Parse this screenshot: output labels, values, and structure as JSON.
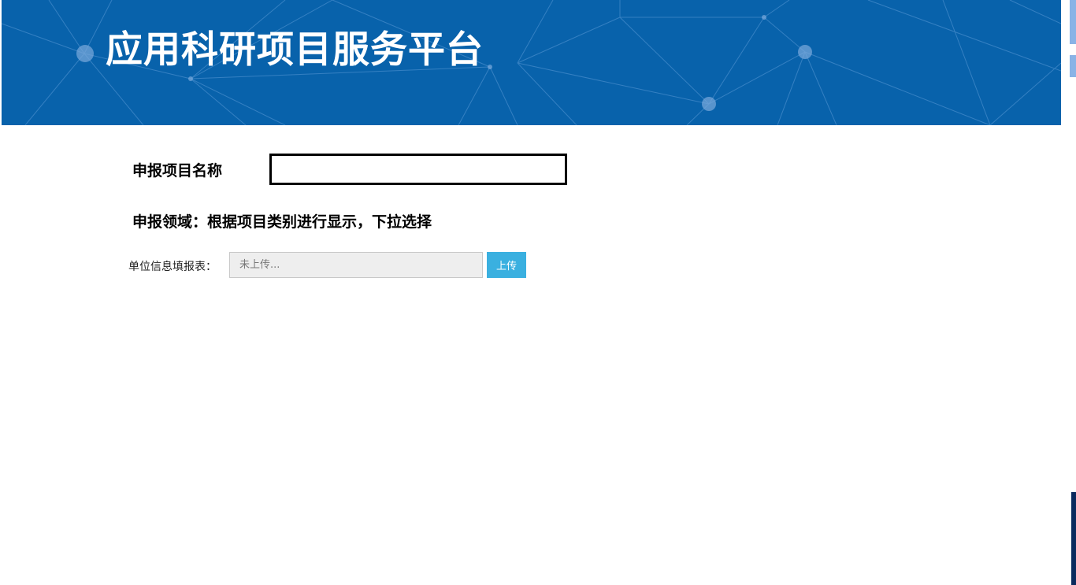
{
  "header": {
    "title": "应用科研项目服务平台",
    "background_color": "#0862ab"
  },
  "form": {
    "project_name": {
      "label": "申报项目名称",
      "value": ""
    },
    "field_note": "申报领域：根据项目类别进行显示，下拉选择",
    "upload": {
      "label": "单位信息填报表：",
      "placeholder": "未上传...",
      "button_label": "上传",
      "button_color": "#3ab0e0"
    }
  }
}
